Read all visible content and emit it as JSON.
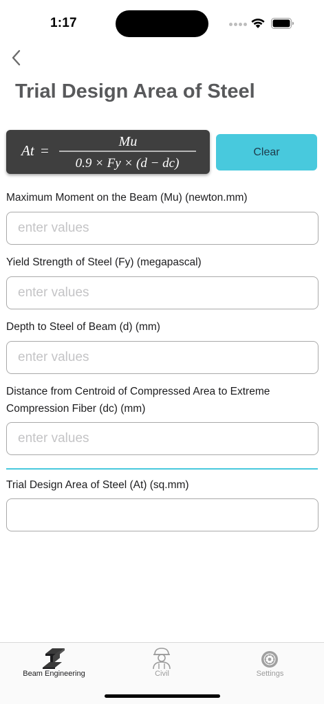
{
  "status_bar": {
    "time": "1:17",
    "icons": [
      "signal-dots-icon",
      "wifi-icon",
      "battery-icon"
    ]
  },
  "nav": {
    "back_icon": "chevron-left-icon",
    "title": "Trial Design Area of Steel"
  },
  "formula": {
    "lhs": "At",
    "equals": "=",
    "numerator": "Mu",
    "denominator": "0.9 × Fy × (d − dc)"
  },
  "clear_button": {
    "label": "Clear"
  },
  "fields": [
    {
      "label": "Maximum Moment on the Beam (Mu) (newton.mm)",
      "placeholder": "enter values",
      "value": ""
    },
    {
      "label": "Yield Strength of Steel (Fy) (megapascal)",
      "placeholder": "enter values",
      "value": ""
    },
    {
      "label": "Depth to Steel of Beam (d) (mm)",
      "placeholder": "enter values",
      "value": ""
    },
    {
      "label": "Distance from Centroid of Compressed Area to Extreme Compression Fiber (dc) (mm)",
      "placeholder": "enter values",
      "value": ""
    }
  ],
  "result": {
    "label": "Trial Design Area of Steel (At) (sq.mm)",
    "value": ""
  },
  "tabs": [
    {
      "label": "Beam Engineering",
      "icon": "steel-beam-icon",
      "active": true
    },
    {
      "label": "Civil",
      "icon": "construction-worker-icon",
      "active": false
    },
    {
      "label": "Settings",
      "icon": "gear-icon",
      "active": false
    }
  ],
  "colors": {
    "accent": "#48c9dd",
    "title": "#58595b",
    "formula_bg": "#3f3f3f",
    "inactive_tab": "#9b9b9b"
  }
}
